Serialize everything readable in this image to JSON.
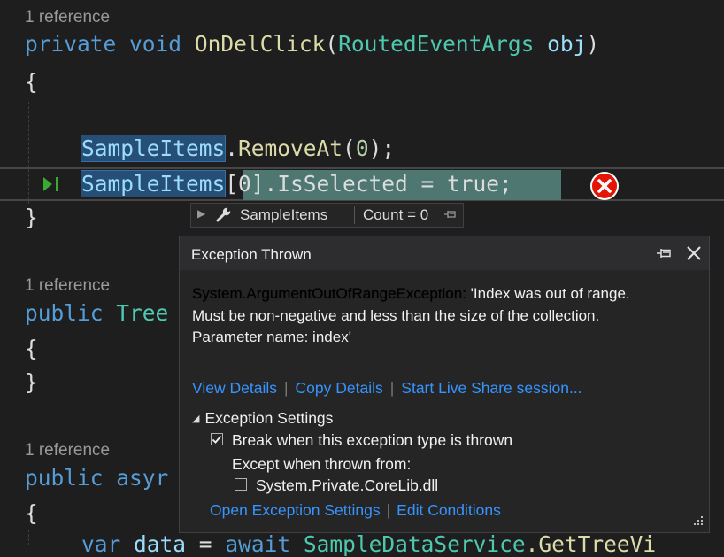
{
  "editor": {
    "codelens_1": "1 reference",
    "codelens_2": "1 reference",
    "codelens_3": "1 reference",
    "method_1": {
      "kw1": "private",
      "kw2": "void",
      "name": "OnDelClick",
      "open": "(",
      "ptype": "RoutedEventArgs",
      "pname": "obj",
      "close": ")"
    },
    "brace_open_1": "{",
    "line_remove": {
      "obj": "SampleItems",
      "dot": ".",
      "method": "RemoveAt",
      "open": "(",
      "num": "0",
      "close": ");"
    },
    "line_current": {
      "obj": "SampleItems",
      "rest": "[0].IsSelected = true;"
    },
    "brace_close_1": "}",
    "method_2": {
      "kw": "public",
      "type": "Tree"
    },
    "brace_open_2": "{",
    "brace_close_2": "}",
    "method_3": {
      "kw": "public",
      "partial": "asyr"
    },
    "brace_open_3": "{",
    "line_partial": {
      "kw": "var",
      "name": "data",
      "eq": " = ",
      "aw": "await",
      "svc": "SampleDataService",
      "rest": ".GetTreeVi"
    }
  },
  "datatip": {
    "name": "SampleItems",
    "value": "Count = 0"
  },
  "exception_popup": {
    "title": "Exception Thrown",
    "exception_type": "System.ArgumentOutOfRangeException:",
    "message_line1": " 'Index was out of range.",
    "message_line2": "Must be non-negative and less than the size of the collection.",
    "message_line3": "Parameter name: index'",
    "links": [
      "View Details",
      "Copy Details",
      "Start Live Share session..."
    ],
    "settings_header": "Exception Settings",
    "break_label": "Break when this exception type is thrown",
    "break_checked": true,
    "except_label": "Except when thrown from:",
    "corelib_label": "System.Private.CoreLib.dll",
    "corelib_checked": false,
    "bottom_links": [
      "Open Exception Settings",
      "Edit Conditions"
    ]
  },
  "colors": {
    "background": "#1e1e1e",
    "keyword": "#569cd6",
    "method": "#dcdcaa",
    "type": "#4ec9b0",
    "link": "#3794ff",
    "error": "#e51400",
    "exception_highlight": "#4d7770"
  },
  "icons": [
    "current-statement-arrow-icon",
    "error-icon",
    "wrench-icon",
    "pin-icon",
    "close-icon",
    "checkmark-icon",
    "resize-grip-icon"
  ]
}
